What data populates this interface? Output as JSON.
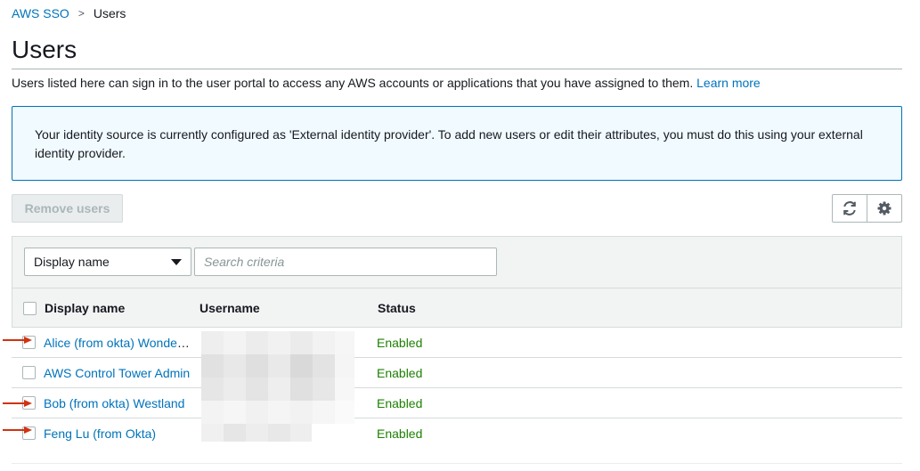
{
  "breadcrumb": {
    "parent": "AWS SSO",
    "separator": ">",
    "current": "Users"
  },
  "page": {
    "title": "Users",
    "description": "Users listed here can sign in to the user portal to access any AWS accounts or applications that you have assigned to them.",
    "learn_more": "Learn more"
  },
  "info_box": {
    "text": "Your identity source is currently configured as 'External identity provider'. To add new users or edit their attributes, you must do this using your external identity provider."
  },
  "toolbar": {
    "remove_label": "Remove users",
    "refresh_icon": "refresh-icon",
    "settings_icon": "gear-icon"
  },
  "filter": {
    "selected": "Display name",
    "search_placeholder": "Search criteria"
  },
  "table": {
    "columns": [
      "Display name",
      "Username",
      "Status"
    ],
    "rows": [
      {
        "display_name": "Alice (from okta) Wonderland",
        "status": "Enabled",
        "arrow": true
      },
      {
        "display_name": "AWS Control Tower Admin",
        "status": "Enabled",
        "arrow": false
      },
      {
        "display_name": "Bob (from okta) Westland",
        "status": "Enabled",
        "arrow": true
      },
      {
        "display_name": "Feng Lu (from Okta)",
        "status": "Enabled",
        "arrow": true
      }
    ]
  },
  "colors": {
    "link": "#0073bb",
    "status_enabled": "#1d8102",
    "info_border": "#0073bb",
    "info_bg": "#f1faff",
    "arrow": "#d13212"
  }
}
